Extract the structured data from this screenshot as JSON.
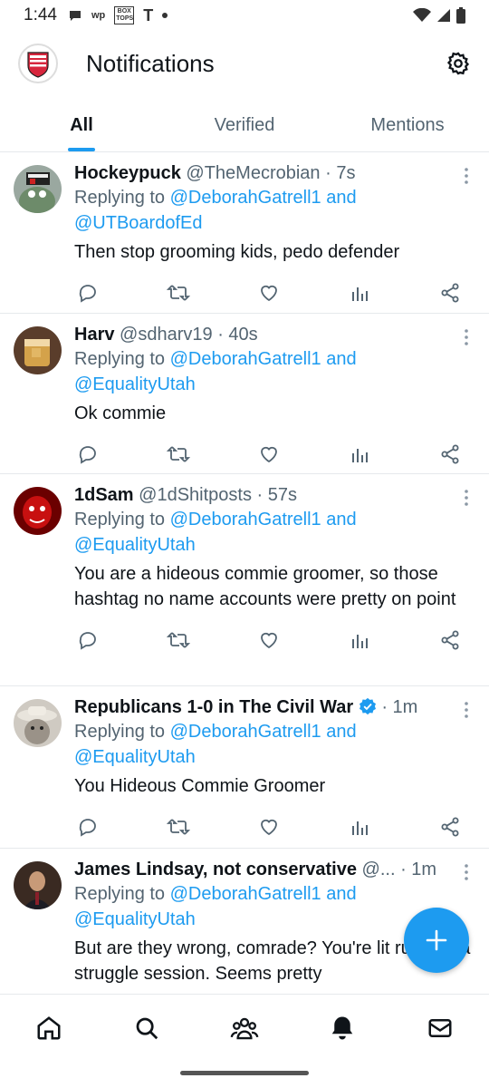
{
  "status_bar": {
    "time": "1:44",
    "chips": [
      "wp",
      "BOX TOPS",
      "T"
    ]
  },
  "header": {
    "title": "Notifications"
  },
  "tabs": [
    {
      "label": "All",
      "active": true
    },
    {
      "label": "Verified",
      "active": false
    },
    {
      "label": "Mentions",
      "active": false
    }
  ],
  "tweets": [
    {
      "name": "Hockeypuck",
      "handle": "@TheMecrobian",
      "time": "· 7s",
      "replying_prefix": "Replying to ",
      "mention1": "@DeborahGatrell1 and",
      "mention2": "@UTBoardofEd",
      "body": "Then stop grooming kids, pedo defender"
    },
    {
      "name": "Harv",
      "handle": "@sdharv19",
      "time": "· 40s",
      "replying_prefix": "Replying to ",
      "mention1": "@DeborahGatrell1 and",
      "mention2": "@EqualityUtah",
      "body": "Ok commie"
    },
    {
      "name": "1dSam",
      "handle": "@1dShitposts",
      "time": "· 57s",
      "replying_prefix": "Replying to ",
      "mention1": "@DeborahGatrell1 and",
      "mention2": "@EqualityUtah",
      "body": "You are a hideous commie groomer, so those hashtag no name accounts were pretty on point"
    },
    {
      "name": "Republicans 1-0 in The Civil War",
      "handle": "",
      "time": "· 1m",
      "replying_prefix": "Replying to ",
      "mention1": "@DeborahGatrell1 and",
      "mention2": "@EqualityUtah",
      "body": "You Hideous Commie Groomer"
    },
    {
      "name": "James Lindsay, not conservative",
      "handle": "@...",
      "time": "· 1m",
      "replying_prefix": "Replying to ",
      "mention1": "@DeborahGatrell1 and",
      "mention2": "@EqualityUtah",
      "body": "But are they wrong, comrade? You're lit running a struggle session. Seems pretty"
    }
  ],
  "colors": {
    "accent": "#1d9bf0",
    "text_primary": "#0f1419",
    "text_secondary": "#536471",
    "divider": "#e6e9ec"
  },
  "icons": {
    "actions": [
      "reply-icon",
      "retweet-icon",
      "like-icon",
      "views-icon",
      "share-icon"
    ],
    "nav": [
      "home-icon",
      "search-icon",
      "communities-icon",
      "notifications-bell-icon",
      "messages-icon"
    ]
  }
}
